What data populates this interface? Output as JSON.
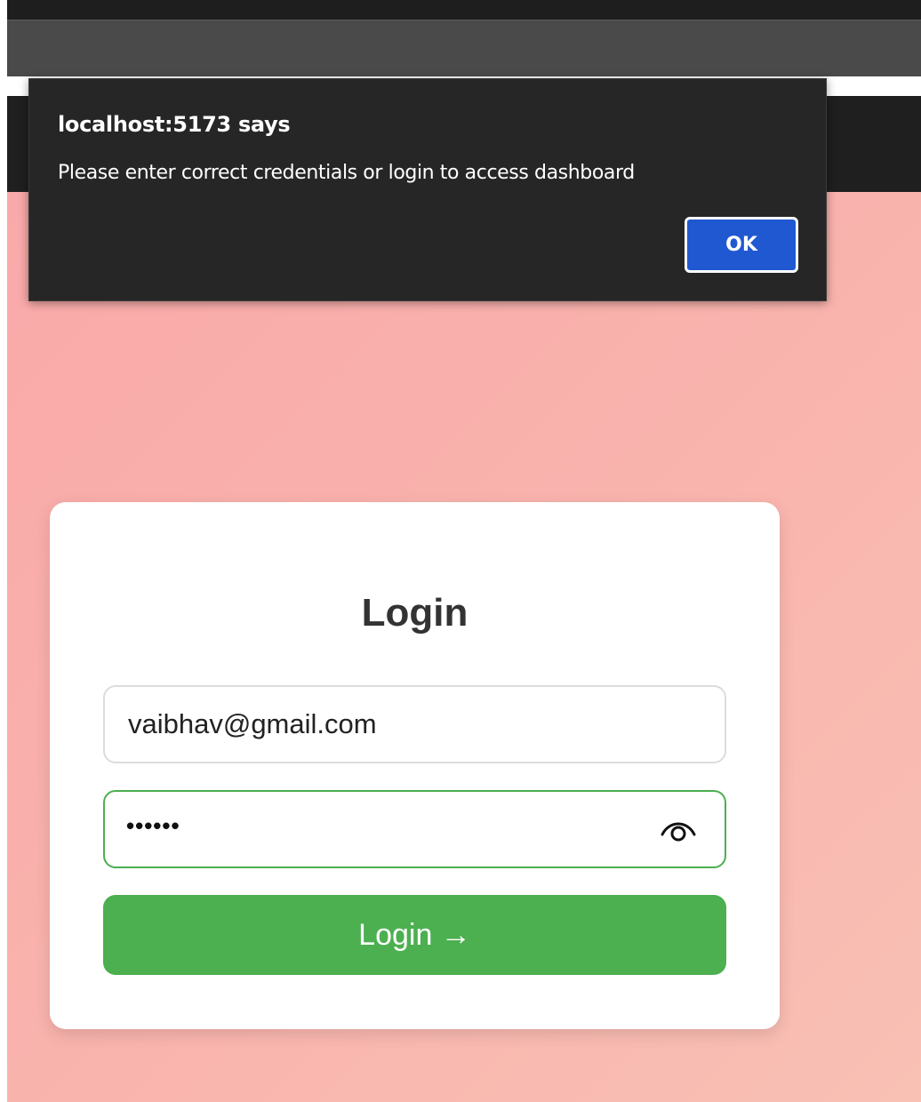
{
  "alert": {
    "title": "localhost:5173 says",
    "message": "Please enter correct credentials or login to access dashboard",
    "ok_label": "OK"
  },
  "login": {
    "title": "Login",
    "email_value": "vaibhav@gmail.com",
    "password_masked": "••••••",
    "button_label": "Login →"
  },
  "icons": {
    "password_toggle": "eye-icon"
  },
  "colors": {
    "page_background": "#f9b0a9",
    "alert_background": "#262626",
    "ok_button": "#2058d2",
    "login_button": "#4caf50",
    "password_border_focus": "#4caf50",
    "navbar": "#1f1f1f"
  }
}
